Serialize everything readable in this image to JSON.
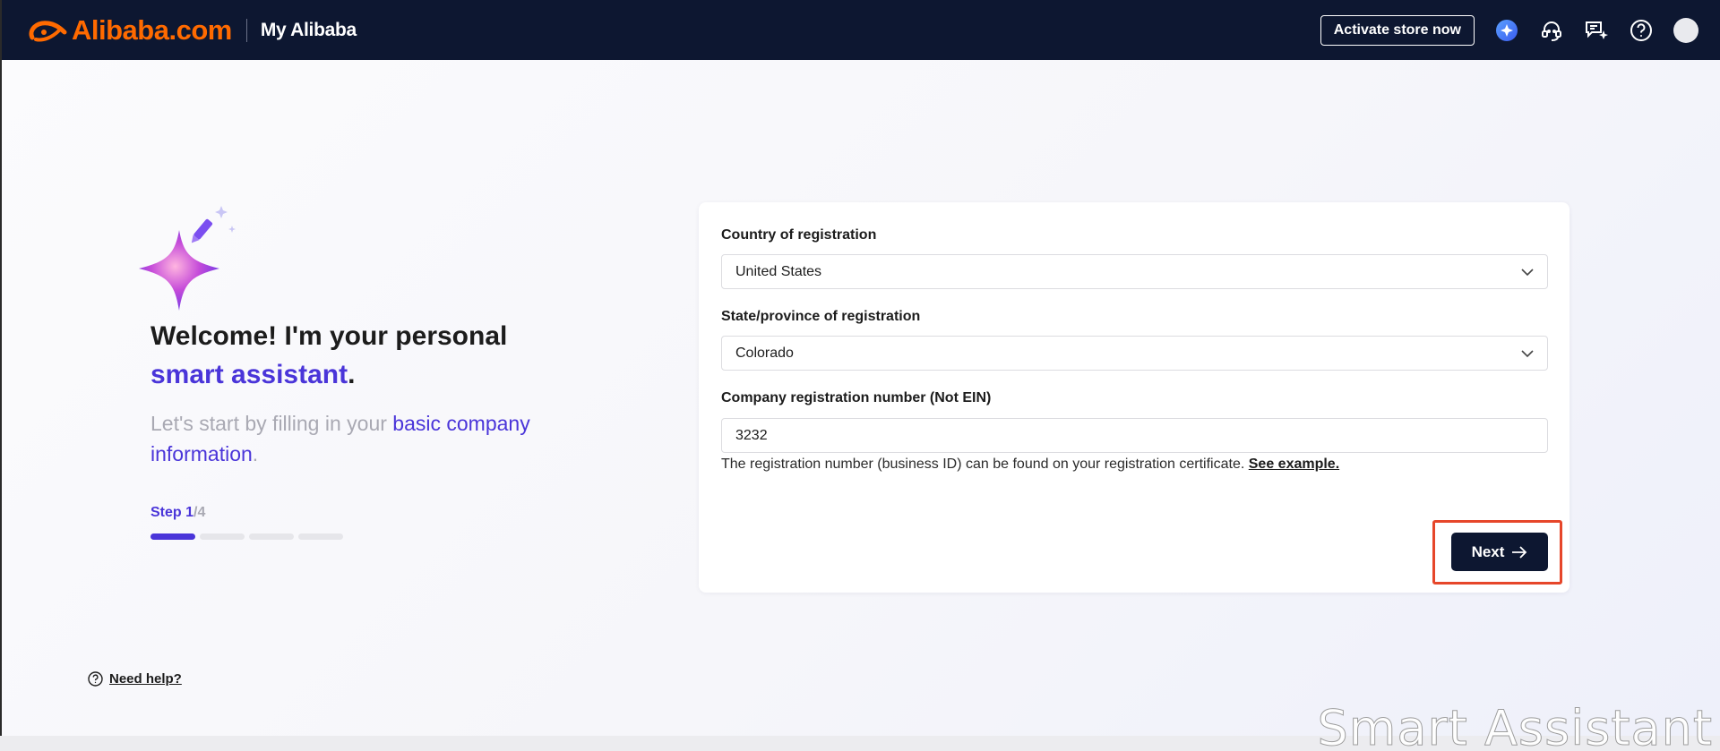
{
  "header": {
    "brand": "Alibaba.com",
    "section": "My Alibaba",
    "activate_label": "Activate store now",
    "icons": [
      "ai-assistant-icon",
      "headset-icon",
      "message-sparkle-icon",
      "help-icon",
      "avatar"
    ]
  },
  "intro": {
    "welcome_prefix": "Welcome! I'm your personal",
    "welcome_accent": "smart assistant",
    "welcome_suffix": ".",
    "lead_prefix": "Let's start by filling in your",
    "lead_accent": "basic company information",
    "lead_suffix": "."
  },
  "step": {
    "label": "Step",
    "current": "1",
    "total": "/4",
    "count": 4
  },
  "form": {
    "country_label": "Country of registration",
    "country_value": "United States",
    "state_label": "State/province of registration",
    "state_value": "Colorado",
    "regnum_label": "Company registration number (Not EIN)",
    "regnum_value": "3232",
    "hint_text": "The registration number (business ID) can be found on your registration certificate.",
    "hint_link": "See example.",
    "next_label": "Next"
  },
  "help": {
    "label": "Need help?"
  },
  "watermark": "Smart Assistant",
  "colors": {
    "header_bg": "#0d1731",
    "brand_orange": "#ff6a00",
    "accent": "#4a35d9",
    "highlight": "#e6462a"
  }
}
